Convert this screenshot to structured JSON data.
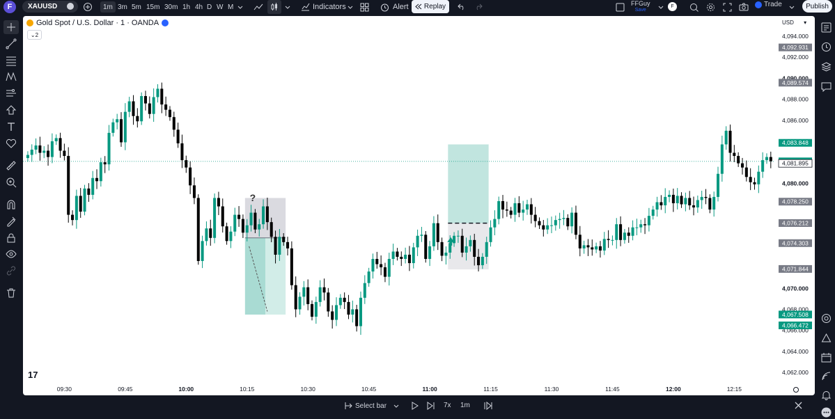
{
  "header": {
    "logo_letter": "F",
    "symbol": "XAUUSD",
    "timeframes": [
      "1m",
      "3m",
      "5m",
      "15m",
      "30m",
      "1h",
      "4h",
      "D",
      "W",
      "M"
    ],
    "active_timeframe": "1m",
    "indicators_label": "Indicators",
    "alert_label": "Alert",
    "replay_label": "Replay",
    "user_name": "FFGuy",
    "user_sub": "Save",
    "avatar_letter": "F",
    "trade_label": "Trade",
    "publish_label": "Publish"
  },
  "legend": {
    "title": "Gold Spot / U.S. Dollar · 1 · OANDA",
    "collapse_count": "2"
  },
  "currency": "USD",
  "price_axis": {
    "ticks": [
      {
        "label": "4,094.000",
        "value": 4094
      },
      {
        "label": "4,092.000",
        "value": 4092
      },
      {
        "label": "4,090.000",
        "value": 4090
      },
      {
        "label": "4,088.000",
        "value": 4088
      },
      {
        "label": "4,086.000",
        "value": 4086
      },
      {
        "label": "4,080.000",
        "value": 4080
      },
      {
        "label": "4,070.000",
        "value": 4070
      },
      {
        "label": "4,068.000",
        "value": 4068
      },
      {
        "label": "4,066.000",
        "value": 4066
      },
      {
        "label": "4,064.000",
        "value": 4064
      },
      {
        "label": "4,062.000",
        "value": 4062
      }
    ],
    "bold_ticks": [
      "4,090.000",
      "4,080.000",
      "4,070.000"
    ],
    "labels": [
      {
        "text": "4,092.931",
        "value": 4092.931,
        "style": "gray"
      },
      {
        "text": "4,089.574",
        "value": 4089.574,
        "style": "gray"
      },
      {
        "text": "4,083.848",
        "value": 4083.848,
        "style": "green"
      },
      {
        "text": "4,082.085",
        "value": 4082.085,
        "style": "green"
      },
      {
        "text": "4,081.895",
        "value": 4081.895,
        "style": "outline"
      },
      {
        "text": "4,078.250",
        "value": 4078.25,
        "style": "gray"
      },
      {
        "text": "4,076.212",
        "value": 4076.212,
        "style": "gray"
      },
      {
        "text": "4,074.303",
        "value": 4074.303,
        "style": "gray"
      },
      {
        "text": "4,071.844",
        "value": 4071.844,
        "style": "gray"
      },
      {
        "text": "4,067.508",
        "value": 4067.508,
        "style": "green"
      },
      {
        "text": "4,066.472",
        "value": 4066.472,
        "style": "green"
      }
    ]
  },
  "time_axis": {
    "ticks": [
      {
        "label": "09:30",
        "bar": 9,
        "bold": false
      },
      {
        "label": "09:45",
        "bar": 24,
        "bold": false
      },
      {
        "label": "10:00",
        "bar": 39,
        "bold": true
      },
      {
        "label": "10:15",
        "bar": 54,
        "bold": false
      },
      {
        "label": "10:30",
        "bar": 69,
        "bold": false
      },
      {
        "label": "10:45",
        "bar": 84,
        "bold": false
      },
      {
        "label": "11:00",
        "bar": 99,
        "bold": true
      },
      {
        "label": "11:15",
        "bar": 114,
        "bold": false
      },
      {
        "label": "11:30",
        "bar": 129,
        "bold": false
      },
      {
        "label": "11:45",
        "bar": 144,
        "bold": false
      },
      {
        "label": "12:00",
        "bar": 159,
        "bold": true
      },
      {
        "label": "12:15",
        "bar": 174,
        "bold": false
      }
    ]
  },
  "chart_data": {
    "type": "candlestick",
    "title": "Gold Spot / U.S. Dollar · 1 · OANDA",
    "ylim": [
      4061,
      4095
    ],
    "current_price_line": 4082.085,
    "closes": [
      4082.7,
      4083.2,
      4083.6,
      4082.9,
      4083.1,
      4082.5,
      4084.0,
      4084.3,
      4083.1,
      4082.6,
      4077.0,
      4076.5,
      4078.8,
      4077.3,
      4079.5,
      4078.9,
      4080.5,
      4080.2,
      4082.0,
      4081.8,
      4084.8,
      4085.8,
      4086.1,
      4083.9,
      4086.8,
      4087.8,
      4086.4,
      4085.9,
      4088.3,
      4087.6,
      4086.6,
      4088.2,
      4089.0,
      4087.5,
      4087.0,
      4086.3,
      4085.1,
      4083.8,
      4082.2,
      4081.5,
      4079.8,
      4078.6,
      4072.6,
      4074.5,
      4075.7,
      4074.8,
      4078.6,
      4077.8,
      4075.9,
      4074.5,
      4075.4,
      4077.0,
      4076.6,
      4075.3,
      4076.0,
      4077.2,
      4075.6,
      4076.1,
      4077.8,
      4076.3,
      4074.9,
      4073.2,
      4074.9,
      4074.4,
      4073.8,
      4070.3,
      4068.0,
      4069.2,
      4070.1,
      4068.5,
      4067.3,
      4068.7,
      4070.1,
      4069.6,
      4067.8,
      4067.0,
      4068.4,
      4069.1,
      4068.7,
      4067.5,
      4068.0,
      4066.4,
      4069.1,
      4070.5,
      4071.6,
      4072.8,
      4072.3,
      4072.0,
      4071.1,
      4072.8,
      4073.5,
      4073.0,
      4072.8,
      4073.2,
      4072.4,
      4073.9,
      4075.0,
      4075.1,
      4072.8,
      4074.0,
      4076.2,
      4074.4,
      4073.1,
      4073.4,
      4074.3,
      4075.0,
      4075.0,
      4073.4,
      4074.0,
      4074.6,
      4073.0,
      4072.2,
      4073.0,
      4074.4,
      4075.8,
      4076.6,
      4078.3,
      4077.5,
      4077.4,
      4077.0,
      4078.1,
      4077.2,
      4077.5,
      4078.0,
      4077.0,
      4076.4,
      4076.0,
      4075.6,
      4076.0,
      4076.0,
      4076.5,
      4076.6,
      4076.7,
      4075.9,
      4077.2,
      4075.1,
      4073.8,
      4074.1,
      4073.9,
      4073.7,
      4074.0,
      4073.6,
      4074.7,
      4074.6,
      4074.6,
      4076.1,
      4074.6,
      4075.3,
      4075.0,
      4075.8,
      4075.8,
      4076.1,
      4076.0,
      4076.9,
      4077.5,
      4078.2,
      4077.9,
      4078.7,
      4078.9,
      4078.1,
      4078.8,
      4078.0,
      4078.6,
      4077.9,
      4077.7,
      4078.4,
      4078.7,
      4078.6,
      4077.5,
      4078.7,
      4080.9,
      4083.7,
      4085.0,
      4082.9,
      4082.6,
      4081.9,
      4081.5,
      4080.6,
      4080.1,
      4079.9,
      4081.1,
      4082.2,
      4082.5,
      4082.1
    ],
    "zones": [
      {
        "name": "gray-box-upper",
        "bars": [
          54,
          64
        ],
        "from": 4078.6,
        "to": 4074.8
      },
      {
        "name": "green-box-lower",
        "bars": [
          54,
          59
        ],
        "from": 4074.8,
        "to": 4067.5
      },
      {
        "name": "light-green-box",
        "bars": [
          59,
          64
        ],
        "from": 4074.8,
        "to": 4067.5
      },
      {
        "name": "long-position-profit",
        "bars": [
          104,
          114
        ],
        "from": 4083.7,
        "to": 4076.2
      },
      {
        "name": "long-position-risk",
        "bars": [
          104,
          114
        ],
        "from": 4076.2,
        "to": 4071.8
      }
    ],
    "markers": [
      {
        "type": "question-mark",
        "bar": 55,
        "price": 4078.3,
        "text": "?"
      },
      {
        "type": "up-arrow",
        "bar": 104,
        "price": 4074.4
      }
    ]
  },
  "bottom": {
    "select_bar_label": "Select bar",
    "speed_label": "7x",
    "interval_label": "1m"
  },
  "colors": {
    "up": "#089981",
    "down": "#000000",
    "background": "#131722",
    "canvas": "#ffffff"
  }
}
